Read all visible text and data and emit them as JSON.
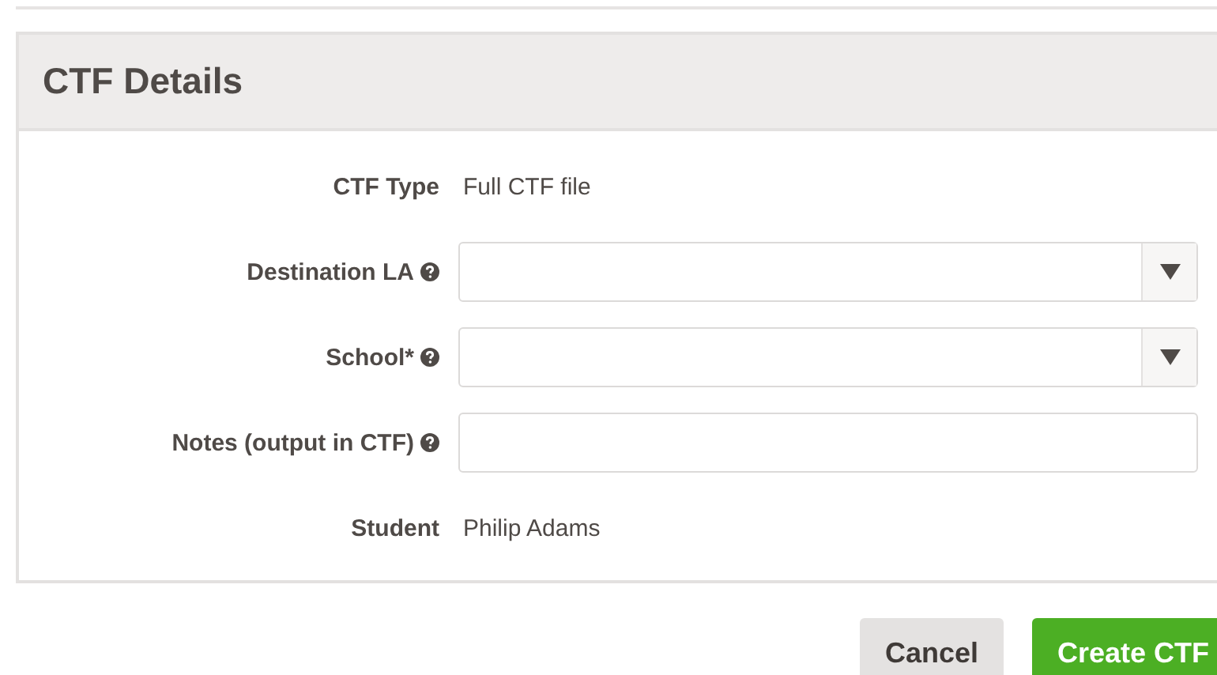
{
  "panel": {
    "title": "CTF Details"
  },
  "rows": [
    {
      "kind": "text",
      "label": "CTF Type",
      "help": false,
      "value": "Full CTF file"
    },
    {
      "kind": "select",
      "label": "Destination LA",
      "help": true
    },
    {
      "kind": "select",
      "label": "School*",
      "help": true
    },
    {
      "kind": "input",
      "label": "Notes (output in CTF)",
      "help": true
    },
    {
      "kind": "text",
      "label": "Student",
      "help": false,
      "value": "Philip Adams"
    }
  ],
  "buttons": [
    {
      "label": "Cancel",
      "kind": "secondary"
    },
    {
      "label": "Create CTF",
      "kind": "primary"
    }
  ]
}
